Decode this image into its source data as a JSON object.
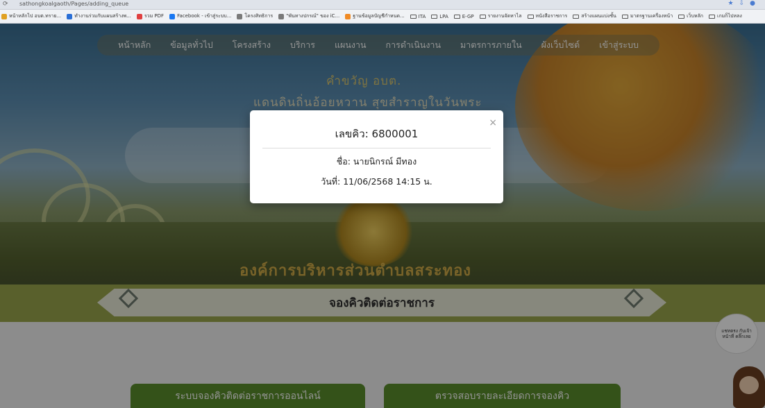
{
  "browser": {
    "url": "sathongkoalgaoth/Pages/adding_queue",
    "bookmarks": [
      {
        "label": "หน้าหลักไป อบต.ทราย...",
        "icon": "site-icon",
        "color": "#e0a020"
      },
      {
        "label": "ทำงานร่วมกับแผนสร้างพ...",
        "icon": "site-icon",
        "color": "#2a6fd6"
      },
      {
        "label": "รวม PDF",
        "icon": "pdf-icon",
        "color": "#e04040"
      },
      {
        "label": "Facebook - เข้าสู่ระบบ...",
        "icon": "facebook-icon",
        "color": "#1877f2"
      },
      {
        "label": "โครงสิทธิการ",
        "icon": "site-icon",
        "color": "#7a7a7a"
      },
      {
        "label": "\"พันทางปกรณ์\" ของ iC...",
        "icon": "site-icon",
        "color": "#7a7a7a"
      },
      {
        "label": "ฐานข้อมูลบัญชีกำหนด...",
        "icon": "site-icon",
        "color": "#f08a24"
      },
      {
        "label": "ITA",
        "icon": "folder-icon"
      },
      {
        "label": "LPA",
        "icon": "folder-icon"
      },
      {
        "label": "E-GP",
        "icon": "folder-icon"
      },
      {
        "label": "รายงานจัดหาไล",
        "icon": "folder-icon"
      },
      {
        "label": "หนังสือราชการ",
        "icon": "folder-icon"
      },
      {
        "label": "สร้างแผนแบ่งชั้น",
        "icon": "folder-icon"
      },
      {
        "label": "มาตรฐานเครื่องหน้า",
        "icon": "folder-icon"
      },
      {
        "label": "เว็บหลัก",
        "icon": "folder-icon"
      },
      {
        "label": "เกมก็ไปหลง",
        "icon": "folder-icon"
      }
    ]
  },
  "nav": {
    "items": [
      "หน้าหลัก",
      "ข้อมูลทั่วไป",
      "โครงสร้าง",
      "บริการ",
      "แผนงาน",
      "การดำเนินงาน",
      "มาตรการภายใน",
      "ผังเว็บไซต์",
      "เข้าสู่ระบบ"
    ]
  },
  "hero": {
    "tagline1": "คำขวัญ อบต.",
    "tagline2": "แดนดินถิ่นอ้อยหวาน สุขสำราญในวันพระ",
    "org_name": "องค์การบริหารส่วนตำบลสระทอง"
  },
  "section": {
    "title": "จองคิวติดต่อราชการ",
    "buttons": [
      "ระบบจองคิวติดต่อราชการออนไลน์",
      "ตรวจสอบรายละเอียดการจองคิว"
    ]
  },
  "help_bubble": "แชทตรง กับเจ้าหน้าที่ คลิ๊กเลย",
  "modal": {
    "title": "เลขคิว: 6800001",
    "name_line": "ชื่อ: นายนิกรณ์ มีทอง",
    "date_line": "วันที่: 11/06/2568 14:15 น.",
    "close": "×"
  }
}
